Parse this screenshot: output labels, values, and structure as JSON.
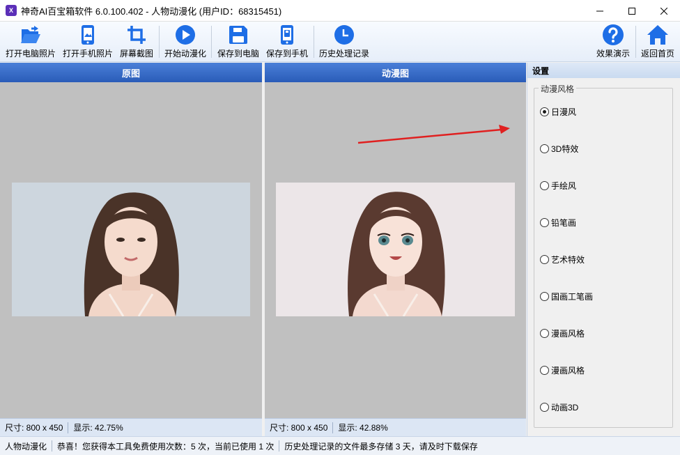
{
  "window": {
    "title": "神奇AI百宝箱软件 6.0.100.402 - 人物动漫化 (用户ID：68315451)",
    "logo_text": "X"
  },
  "toolbar": {
    "open_pc_photo": "打开电脑照片",
    "open_phone_photo": "打开手机照片",
    "screen_capture": "屏幕截图",
    "start_anime": "开始动漫化",
    "save_to_pc": "保存到电脑",
    "save_to_phone": "保存到手机",
    "history": "历史处理记录",
    "demo": "效果演示",
    "home": "返回首页"
  },
  "left_panel": {
    "title": "原图",
    "size_label": "尺寸: 800 x 450",
    "zoom_label": "显示: 42.75%"
  },
  "right_panel": {
    "title": "动漫图",
    "size_label": "尺寸: 800 x 450",
    "zoom_label": "显示: 42.88%"
  },
  "settings": {
    "title": "设置",
    "group_label": "动漫风格",
    "options": [
      "日漫风",
      "3D特效",
      "手绘风",
      "铅笔画",
      "艺术特效",
      "国画工笔画",
      "漫画风格",
      "漫画风格",
      "动画3D"
    ],
    "selected_index": 0
  },
  "statusbar": {
    "module": "人物动漫化",
    "usage": "恭喜！您获得本工具免费使用次数：5 次，当前已使用 1 次",
    "history_note": "历史处理记录的文件最多存储 3 天，请及时下载保存"
  },
  "colors": {
    "accent": "#1e6ee6",
    "panel_header": "#2a5cb8",
    "arrow": "#e02020"
  }
}
